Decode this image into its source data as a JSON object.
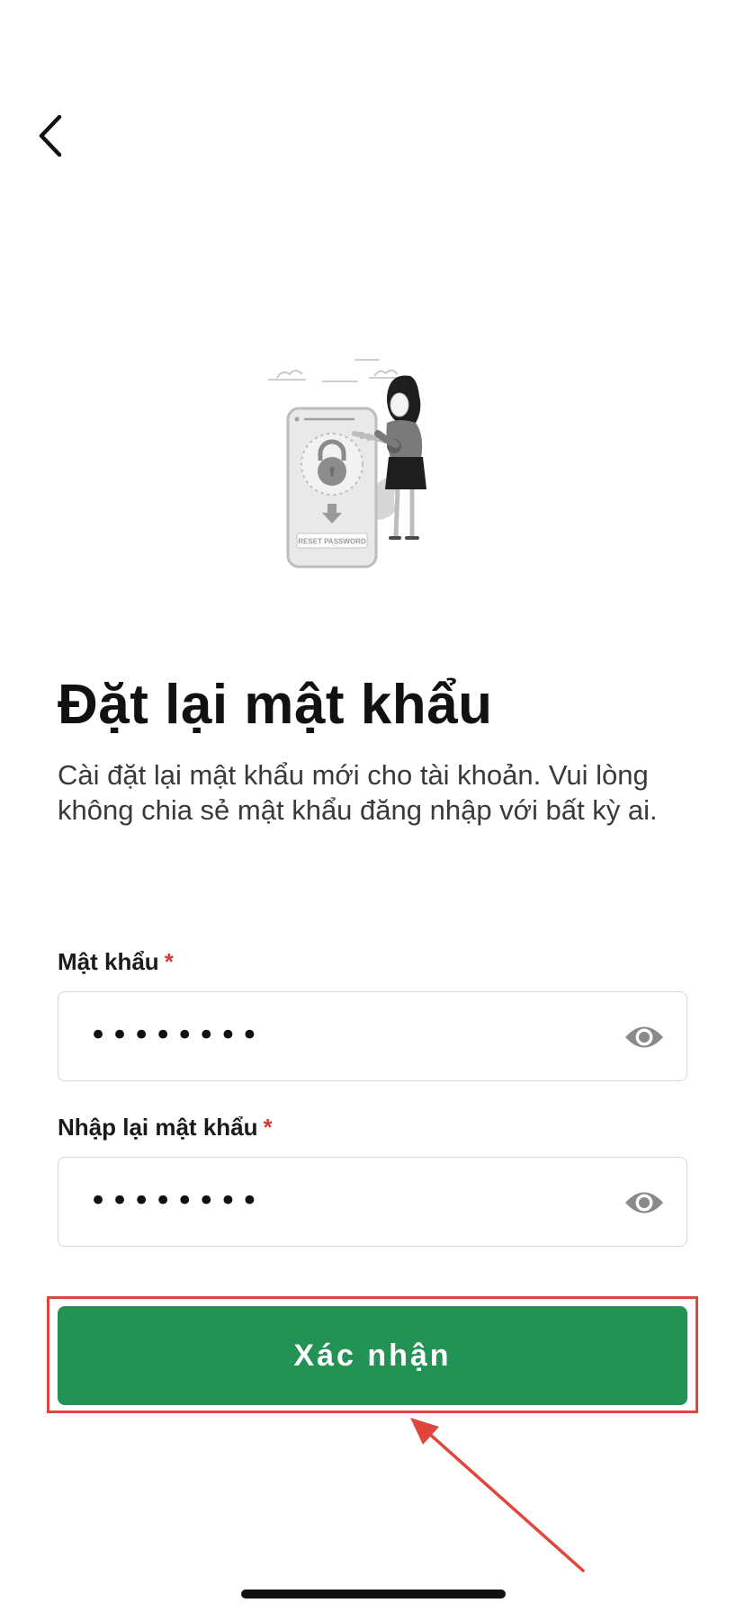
{
  "header": {
    "back_icon": "chevron-left-icon"
  },
  "illustration": {
    "caption": "RESET PASSWORD"
  },
  "main": {
    "title": "Đặt lại mật khẩu",
    "subtitle": "Cài đặt lại mật khẩu mới cho tài khoản. Vui lòng không chia sẻ mật khẩu đăng nhập với bất kỳ ai."
  },
  "form": {
    "password": {
      "label": "Mật khẩu",
      "required_mark": "*",
      "value": "••••••••",
      "toggle_icon": "eye-icon"
    },
    "confirm_password": {
      "label": "Nhập lại mật khẩu",
      "required_mark": "*",
      "value": "••••••••",
      "toggle_icon": "eye-icon"
    },
    "submit_label": "Xác nhận"
  },
  "colors": {
    "primary_button": "#239355",
    "required_asterisk": "#d63b34",
    "annotation": "#e0463c"
  }
}
